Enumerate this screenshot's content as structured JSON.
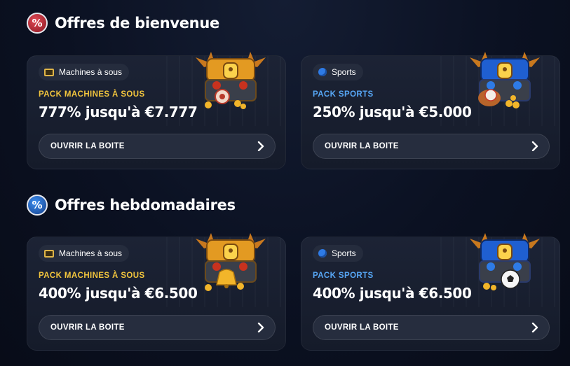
{
  "welcome": {
    "title": "Offres de bienvenue",
    "cards": [
      {
        "tag": "Machines à sous",
        "pack": "PACK MACHINES À SOUS",
        "offer": "777% jusqu'à €7.777",
        "button": "OUVRIR LA BOITE"
      },
      {
        "tag": "Sports",
        "pack": "PACK SPORTS",
        "offer": "250% jusqu'à €5.000",
        "button": "OUVRIR LA BOITE"
      }
    ]
  },
  "weekly": {
    "title": "Offres hebdomadaires",
    "cards": [
      {
        "tag": "Machines à sous",
        "pack": "PACK MACHINES À SOUS",
        "offer": "400% jusqu'à €6.500",
        "button": "OUVRIR LA BOITE"
      },
      {
        "tag": "Sports",
        "pack": "PACK SPORTS",
        "offer": "400% jusqu'à €6.500",
        "button": "OUVRIR LA BOITE"
      }
    ]
  },
  "colors": {
    "gold": "#f2c53d",
    "blue": "#57a6f5",
    "card_bg": "#1c2335",
    "button_bg": "#262d3e"
  },
  "icons": {
    "welcome_section": "percent-potion-red-icon",
    "weekly_section": "percent-potion-blue-icon",
    "slots_tag": "slot-machine-icon",
    "sports_tag": "ball-icon",
    "button": "chevron-right-icon",
    "gold_chest": "gold-treasure-chest-icon",
    "blue_chest": "blue-treasure-chest-icon"
  }
}
